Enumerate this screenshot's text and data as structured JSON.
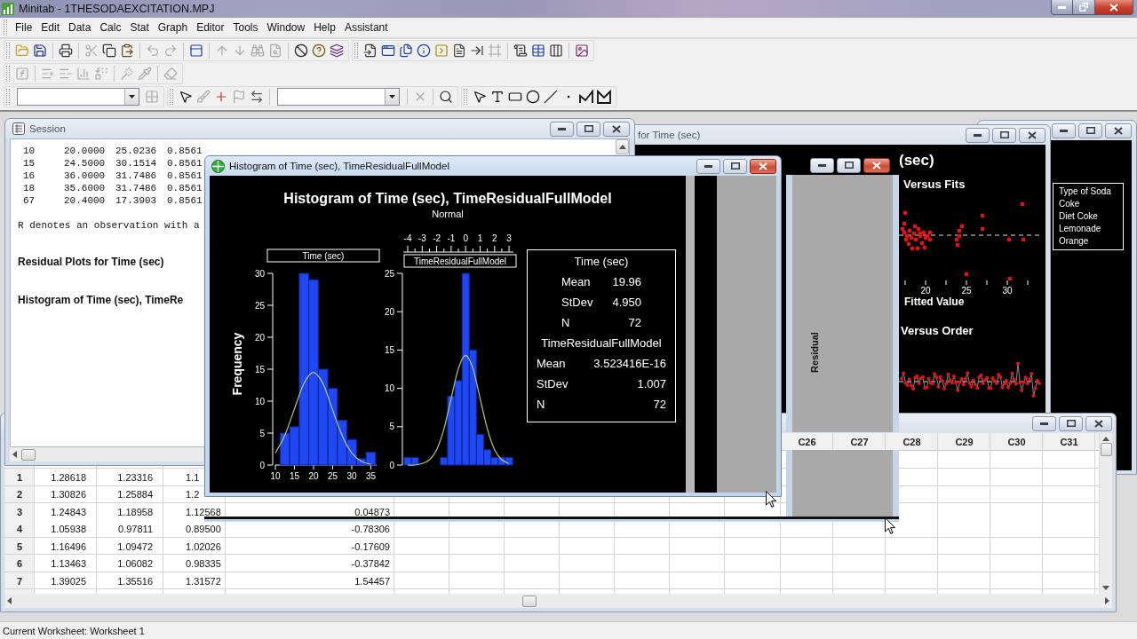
{
  "window": {
    "title": "Minitab - 1THESODAEXCITATION.MPJ"
  },
  "menu": [
    "File",
    "Edit",
    "Data",
    "Calc",
    "Stat",
    "Graph",
    "Editor",
    "Tools",
    "Window",
    "Help",
    "Assistant"
  ],
  "toolbars": [
    {
      "buttons": [
        {
          "disabled": false
        },
        {
          "disabled": false
        },
        {
          "disabled": false
        },
        {
          "disabled": true
        },
        {
          "disabled": false
        },
        {
          "disabled": false
        },
        {
          "disabled": true
        },
        {
          "disabled": true
        },
        {
          "disabled": false
        },
        {
          "disabled": true
        },
        {
          "disabled": true
        },
        {
          "disabled": true
        },
        {
          "disabled": true
        },
        {
          "disabled": false
        },
        {
          "disabled": false
        },
        {
          "disabled": false
        },
        {
          "disabled": false
        },
        {
          "disabled": false
        },
        {
          "disabled": false
        },
        {
          "disabled": false
        },
        {
          "disabled": false
        },
        {
          "disabled": false
        },
        {
          "disabled": false
        },
        {
          "disabled": true
        },
        {
          "disabled": false
        },
        {
          "disabled": false
        },
        {
          "disabled": false
        },
        {
          "disabled": false
        }
      ]
    },
    {
      "buttons": [
        {
          "disabled": true
        },
        {
          "disabled": true
        },
        {
          "disabled": true
        },
        {
          "disabled": true
        },
        {
          "disabled": true
        },
        {
          "disabled": true
        },
        {
          "disabled": true
        },
        {
          "disabled": true
        }
      ]
    },
    {
      "buttons": [
        {
          "disabled": true
        },
        {
          "disabled": false
        },
        {
          "disabled": true
        },
        {
          "disabled": false
        },
        {
          "disabled": true
        },
        {
          "disabled": false
        },
        {
          "disabled": true
        },
        {
          "disabled": false
        },
        {
          "disabled": false
        },
        {
          "disabled": false
        },
        {
          "disabled": false
        },
        {
          "disabled": false
        },
        {
          "disabled": false
        },
        {
          "disabled": false
        },
        {
          "disabled": false
        },
        {
          "disabled": false
        }
      ]
    }
  ],
  "legend_window": {
    "active": false,
    "legend": {
      "title": "Type of Soda",
      "items": [
        "Coke",
        "Diet Coke",
        "Lemonade",
        "Orange"
      ]
    }
  },
  "residual_window": {
    "active": false,
    "title": "for Time (sec)",
    "graph_title": "(sec)",
    "versus_fits": {
      "title": "Versus Fits",
      "x_tick_labels": [
        "20",
        "25",
        "30"
      ],
      "xlabel": "Fitted Value"
    },
    "versus_order": {
      "title": "Versus Order"
    }
  },
  "worksheet_window": {
    "active": false,
    "columns": [
      "C26",
      "C27",
      "C28",
      "C29",
      "C30",
      "C31"
    ],
    "rows": [
      {
        "row": "1",
        "column_1": "1.28618",
        "column_2": "1.23316",
        "column_3": "1.1"
      },
      {
        "row": "2",
        "column_1": "1.30826",
        "column_2": "1.25884",
        "column_3": "1.2"
      },
      {
        "row": "3",
        "column_1": "1.24843",
        "column_2": "1.18958",
        "column_3": "1.12568",
        "column_4": "0.04873"
      },
      {
        "row": "4",
        "column_1": "1.05938",
        "column_2": "0.97811",
        "column_3": "0.89500",
        "column_4": "-0.78306"
      },
      {
        "row": "5",
        "column_1": "1.16496",
        "column_2": "1.09472",
        "column_3": "1.02026",
        "column_4": "-0.17609"
      },
      {
        "row": "6",
        "column_1": "1.13463",
        "column_2": "1.06082",
        "column_3": "0.98335",
        "column_4": "-0.37842"
      },
      {
        "row": "7",
        "column_1": "1.39025",
        "column_2": "1.35516",
        "column_3": "1.31572",
        "column_4": "1.54457"
      }
    ]
  },
  "session_window": {
    "active": false,
    "title": "Session",
    "output_rows": [
      [
        "10",
        "20.0000",
        "25.0236",
        "0.8561"
      ],
      [
        "15",
        "24.5000",
        "30.1514",
        "0.8561"
      ],
      [
        "16",
        "36.0000",
        "31.7486",
        "0.8561"
      ],
      [
        "18",
        "35.6000",
        "31.7486",
        "0.8561"
      ],
      [
        "67",
        "20.4000",
        "17.3903",
        "0.8561"
      ]
    ],
    "note": "R denotes an observation with a",
    "headings": [
      "Residual Plots for Time (sec)",
      "Histogram of Time (sec), TimeRe"
    ]
  },
  "histogram_window": {
    "active": true,
    "title": "Histogram of Time (sec), TimeResidualFullModel",
    "graph": {
      "title": "Histogram of Time (sec), TimeResidualFullModel",
      "subtitle": "Normal",
      "ylabel": "Frequency",
      "panels": [
        {
          "chart_data": {
            "type": "bar",
            "title": "Time (sec)",
            "x": [
              10,
              12.5,
              15,
              17.5,
              20,
              22.5,
              25,
              27.5,
              30,
              32.5,
              35
            ],
            "series": [
              {
                "type": "bar",
                "color": "#1f47f2",
                "values": [
                  0,
                  5,
                  6,
                  30,
                  29,
                  15,
                  12,
                  7,
                  4,
                  1,
                  2
                ]
              },
              {
                "type": "line",
                "color": "#b9c96f",
                "values": [
                  1.9,
                  4.7,
                  8.8,
                  12.8,
                  14.5,
                  12.7,
                  8.6,
                  4.6,
                  1.9,
                  0.6,
                  0.1
                ]
              }
            ],
            "xlim": [
              10,
              36.5
            ],
            "xticks": [
              10,
              15,
              20,
              25,
              30,
              35
            ],
            "yticks": [
              0,
              5,
              10,
              15,
              20,
              25,
              30
            ],
            "ylim": [
              0,
              30
            ]
          }
        },
        {
          "chart_data": {
            "type": "bar",
            "title": "TimeResidualFullModel",
            "x": [
              -4,
              -3.5,
              -3,
              -2.5,
              -2,
              -1.5,
              -1,
              -0.5,
              0,
              0.5,
              1,
              1.5,
              2,
              2.5,
              3
            ],
            "series": [
              {
                "type": "bar",
                "color": "#1f47f2",
                "values": [
                  1,
                  1,
                  0,
                  0,
                  0,
                  1,
                  9,
                  11,
                  25,
                  15,
                  4,
                  2,
                  1,
                  1,
                  1
                ]
              },
              {
                "type": "line",
                "color": "#b9c96f",
                "values": [
                  0,
                  0,
                  0.2,
                  0.7,
                  2,
                  4.7,
                  8.7,
                  12.6,
                  14.3,
                  12.6,
                  8.7,
                  4.7,
                  2,
                  0.7,
                  0.2
                ]
              }
            ],
            "xlim": [
              -4.3,
              3.3
            ],
            "xticks": [
              -4,
              -3,
              -2,
              -1,
              0,
              1,
              2,
              3
            ],
            "yticks": [
              0,
              5,
              10,
              15,
              20,
              25
            ],
            "ylim": [
              0,
              25
            ]
          }
        }
      ],
      "stats": [
        {
          "name": "Time (sec)",
          "rows": [
            {
              "label": "Mean",
              "value": "19.96"
            },
            {
              "label": "StDev",
              "value": "4.950"
            },
            {
              "label": "N",
              "value": "72"
            }
          ]
        },
        {
          "name": "TimeResidualFullModel",
          "rows": [
            {
              "label": "Mean",
              "value": "3.523416E-16"
            },
            {
              "label": "StDev",
              "value": "1.007"
            },
            {
              "label": "N",
              "value": "72"
            }
          ]
        }
      ]
    }
  },
  "ghost_window": {
    "active": true,
    "axis_label": "Residual"
  },
  "status_bar": {
    "text": "Current Worksheet: Worksheet 1"
  }
}
